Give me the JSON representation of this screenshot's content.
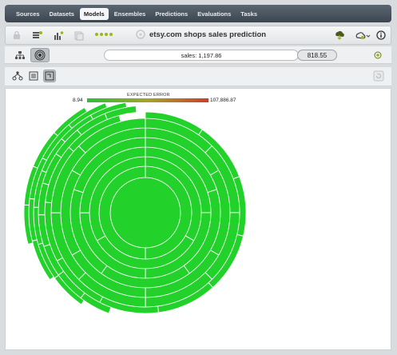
{
  "nav": {
    "items": [
      "Sources",
      "Datasets",
      "Models",
      "Ensembles",
      "Predictions",
      "Evaluations",
      "Tasks"
    ],
    "active": "Models"
  },
  "toolbar": {
    "title": "etsy.com shops sales prediction"
  },
  "prediction": {
    "text": "sales: 1,197.86",
    "error": "818.55"
  },
  "legend": {
    "title": "EXPECTED ERROR",
    "min": "8.94",
    "max": "107,886.87"
  },
  "colors": {
    "leaf_green": "#22d22a",
    "error_low": "#2ebd3a",
    "error_high": "#c9402c",
    "accent": "#9cb51c"
  }
}
